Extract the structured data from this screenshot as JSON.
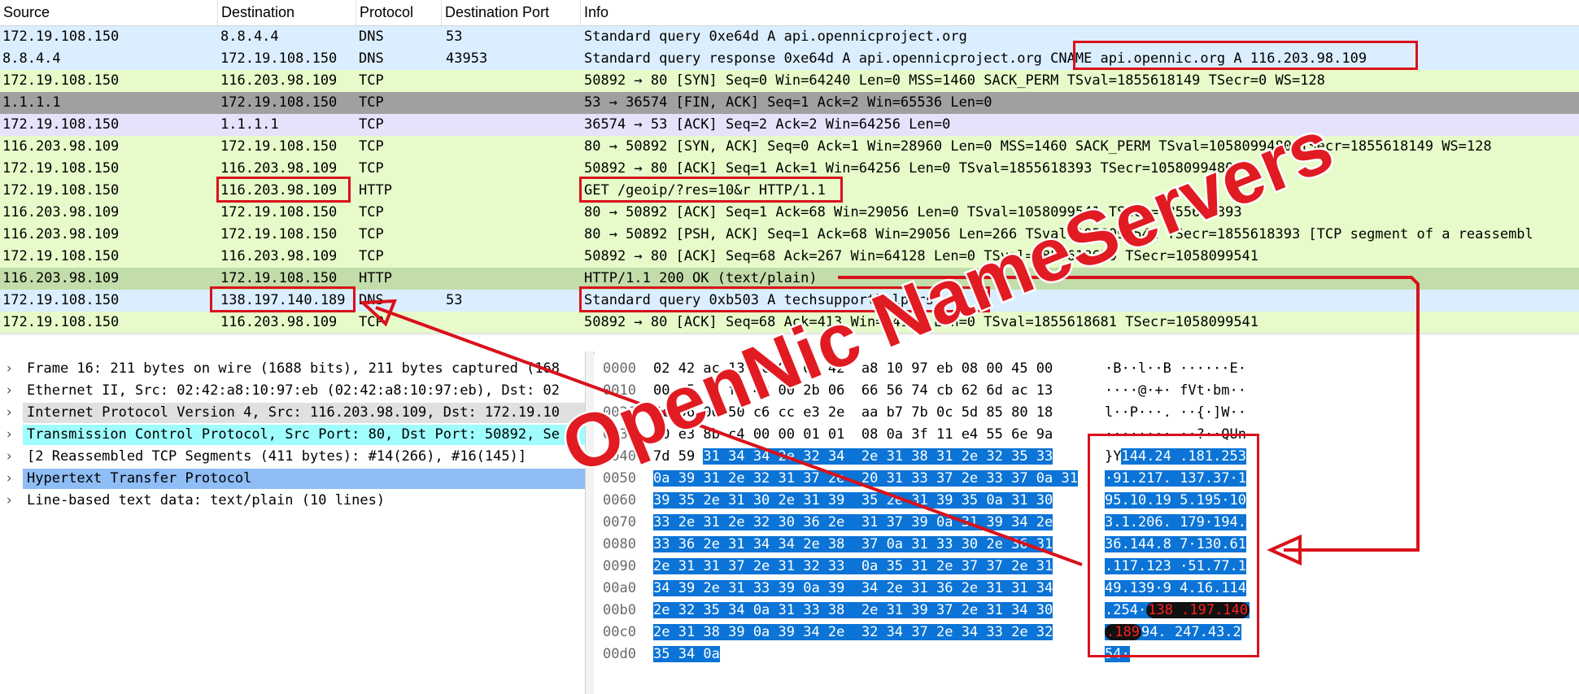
{
  "columns": {
    "source": "Source",
    "destination": "Destination",
    "protocol": "Protocol",
    "port": "Destination Port",
    "info": "Info"
  },
  "packets": [
    {
      "source": "172.19.108.150",
      "destination": "8.8.4.4",
      "protocol": "DNS",
      "port": "53",
      "info": "Standard query 0xe64d A api.opennicproject.org",
      "bg": "#dbeeff"
    },
    {
      "source": "8.8.4.4",
      "destination": "172.19.108.150",
      "protocol": "DNS",
      "port": "43953",
      "info": "Standard query response 0xe64d A api.opennicproject.org CNAME api.opennic.org A 116.203.98.109",
      "bg": "#dbeeff"
    },
    {
      "source": "172.19.108.150",
      "destination": "116.203.98.109",
      "protocol": "TCP",
      "port": "",
      "info": "50892 → 80 [SYN] Seq=0 Win=64240 Len=0 MSS=1460 SACK_PERM TSval=1855618149 TSecr=0 WS=128",
      "bg": "#e6fbc9"
    },
    {
      "source": "1.1.1.1",
      "destination": "172.19.108.150",
      "protocol": "TCP",
      "port": "",
      "info": "53 → 36574 [FIN, ACK] Seq=1 Ack=2 Win=65536 Len=0",
      "bg": "#a0a0a0"
    },
    {
      "source": "172.19.108.150",
      "destination": "1.1.1.1",
      "protocol": "TCP",
      "port": "",
      "info": "36574 → 53 [ACK] Seq=2 Ack=2 Win=64256 Len=0",
      "bg": "#e6e2fb"
    },
    {
      "source": "116.203.98.109",
      "destination": "172.19.108.150",
      "protocol": "TCP",
      "port": "",
      "info": "80 → 50892 [SYN, ACK] Seq=0 Ack=1 Win=28960 Len=0 MSS=1460 SACK_PERM TSval=1058099480 TSecr=1855618149 WS=128",
      "bg": "#e6fbc9"
    },
    {
      "source": "172.19.108.150",
      "destination": "116.203.98.109",
      "protocol": "TCP",
      "port": "",
      "info": "50892 → 80 [ACK] Seq=1 Ack=1 Win=64256 Len=0 TSval=1855618393 TSecr=1058099480",
      "bg": "#e6fbc9"
    },
    {
      "source": "172.19.108.150",
      "destination": "116.203.98.109",
      "protocol": "HTTP",
      "port": "",
      "info": "GET /geoip/?res=10&r HTTP/1.1",
      "bg": "#e6fbc9"
    },
    {
      "source": "116.203.98.109",
      "destination": "172.19.108.150",
      "protocol": "TCP",
      "port": "",
      "info": "80 → 50892 [ACK] Seq=1 Ack=68 Win=29056 Len=0 TSval=1058099541 TSecr=1855618393",
      "bg": "#e6fbc9"
    },
    {
      "source": "116.203.98.109",
      "destination": "172.19.108.150",
      "protocol": "TCP",
      "port": "",
      "info": "80 → 50892 [PSH, ACK] Seq=1 Ack=68 Win=29056 Len=266 TSval=1058099541 TSecr=1855618393 [TCP segment of a reassembl",
      "bg": "#e6fbc9"
    },
    {
      "source": "172.19.108.150",
      "destination": "116.203.98.109",
      "protocol": "TCP",
      "port": "",
      "info": "50892 → 80 [ACK] Seq=68 Ack=267 Win=64128 Len=0 TSval=1855618639 TSecr=1058099541",
      "bg": "#e6fbc9"
    },
    {
      "source": "116.203.98.109",
      "destination": "172.19.108.150",
      "protocol": "HTTP",
      "port": "",
      "info": "HTTP/1.1 200 OK  (text/plain)",
      "bg": "#c3ddaa"
    },
    {
      "source": "172.19.108.150",
      "destination": "138.197.140.189",
      "protocol": "DNS",
      "port": "53",
      "info": "Standard query 0xb503 A techsupporthelpars.oss",
      "bg": "#dbeeff"
    },
    {
      "source": "172.19.108.150",
      "destination": "116.203.98.109",
      "protocol": "TCP",
      "port": "",
      "info": "50892 → 80 [ACK] Seq=68 Ack=413 Win=64128 Len=0 TSval=1855618681 TSecr=1058099541",
      "bg": "#e6fbc9"
    }
  ],
  "details": [
    {
      "text": "Frame 16: 211 bytes on wire (1688 bits), 211 bytes captured (168",
      "expander": "›",
      "bg": ""
    },
    {
      "text": "Ethernet II, Src: 02:42:a8:10:97:eb (02:42:a8:10:97:eb), Dst: 02",
      "expander": "›",
      "bg": ""
    },
    {
      "text": "Internet Protocol Version 4, Src: 116.203.98.109, Dst: 172.19.10",
      "expander": "›",
      "bg": "#e0e0e0"
    },
    {
      "text": "Transmission Control Protocol, Src Port: 80, Dst Port: 50892, Se",
      "expander": "›",
      "bg": "#9ffdfd"
    },
    {
      "text": "[2 Reassembled TCP Segments (411 bytes): #14(266), #16(145)]",
      "expander": "›",
      "bg": ""
    },
    {
      "text": "Hypertext Transfer Protocol",
      "expander": "›",
      "bg": "#8fbdf5"
    },
    {
      "text": "Line-based text data: text/plain (10 lines)",
      "expander": "›",
      "bg": ""
    }
  ],
  "hex": [
    {
      "offset": "0000",
      "plain": "02 42 ac 13 6c 96 02 42  a8 10 97 eb 08 00 45 00",
      "sel": "",
      "ascii_plain": "·B··l··B ······E·",
      "ascii_sel": ""
    },
    {
      "offset": "0010",
      "plain": "00 c5 f8 fa 40 00 2b 06  66 56 74 cb 62 6d ac 13",
      "sel": "",
      "ascii_plain": "····@·+· fVt·bm··",
      "ascii_sel": ""
    },
    {
      "offset": "0020",
      "plain": "6c 96 00 50 c6 cc e3 2e  aa b7 7b 0c 5d 85 80 18",
      "sel": "",
      "ascii_plain": "l··P···. ··{·]W··",
      "ascii_sel": ""
    },
    {
      "offset": "0030",
      "plain": "00 e3 8b c4 00 00 01 01  08 0a 3f 11 e4 55 6e 9a",
      "sel": "",
      "ascii_plain": "········ ··?··QUn",
      "ascii_sel": ""
    },
    {
      "offset": "0040",
      "plain": "7d 59 ",
      "sel": "31 34 34 2e 32 34  2e 31 38 31 2e 32 35 33",
      "ascii_plain": "}Y",
      "ascii_sel": "144.24 .181.253"
    },
    {
      "offset": "0050",
      "plain": "",
      "sel": "0a 39 31 2e 32 31 37 2e  20 31 33 37 2e 33 37 0a 31",
      "ascii_plain": "",
      "ascii_sel": "·91.217. 137.37·1"
    },
    {
      "offset": "0060",
      "plain": "",
      "sel": "39 35 2e 31 30 2e 31 39  35 2e 31 39 35 0a 31 30",
      "ascii_plain": "",
      "ascii_sel": "95.10.19 5.195·10"
    },
    {
      "offset": "0070",
      "plain": "",
      "sel": "33 2e 31 2e 32 30 36 2e  31 37 39 0a 31 39 34 2e",
      "ascii_plain": "",
      "ascii_sel": "3.1.206. 179·194."
    },
    {
      "offset": "0080",
      "plain": "",
      "sel": "33 36 2e 31 34 34 2e 38  37 0a 31 33 30 2e 36 31",
      "ascii_plain": "",
      "ascii_sel": "36.144.8 7·130.61"
    },
    {
      "offset": "0090",
      "plain": "",
      "sel": "2e 31 31 37 2e 31 32 33  0a 35 31 2e 37 37 2e 31",
      "ascii_plain": "",
      "ascii_sel": ".117.123 ·51.77.1"
    },
    {
      "offset": "00a0",
      "plain": "",
      "sel": "34 39 2e 31 33 39 0a 39  34 2e 31 36 2e 31 31 34",
      "ascii_plain": "",
      "ascii_sel": "49.139·9 4.16.114"
    },
    {
      "offset": "00b0",
      "plain": "",
      "sel": "2e 32 35 34 0a 31 33 38  2e 31 39 37 2e 31 34 30",
      "ascii_plain": "",
      "ascii_sel": ".254·"
    },
    {
      "offset": "00c0",
      "plain": "",
      "sel": "2e 31 38 39 0a 39 34 2e  32 34 37 2e 34 33 2e 32",
      "ascii_plain": "",
      "ascii_sel": "94. 247.43.2"
    },
    {
      "offset": "00d0",
      "plain": "",
      "sel": "35 34 0a",
      "ascii_plain": "",
      "ascii_sel": "54·"
    }
  ],
  "hex_highlight": {
    "part1": "138 .197.140",
    "part2": ".189"
  },
  "overlay": {
    "text": "OpenNic NameServers"
  },
  "colors": {
    "annotation_red": "#d9111b",
    "selection_blue": "#0b74d6"
  }
}
